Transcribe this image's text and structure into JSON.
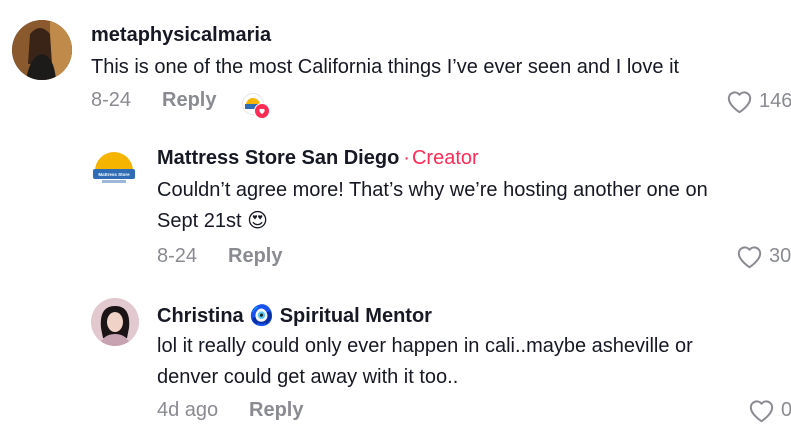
{
  "comments": [
    {
      "username": "metaphysicalmaria",
      "text": "This is one of the most California things I’ve ever seen and I love it",
      "date": "8-24",
      "reply_label": "Reply",
      "likes": "146",
      "creator_liked": true
    },
    {
      "username": "Mattress Store San Diego",
      "badge_separator": "·",
      "badge": "Creator",
      "text_line1": "Couldn’t agree more! That’s why we’re hosting another one on",
      "text_line2": "Sept 21st",
      "emoji": "😍",
      "date": "8-24",
      "reply_label": "Reply",
      "likes": "30",
      "avatar_text": "Mattress Store"
    },
    {
      "username": "Christina",
      "username_emoji": "🧿",
      "username_suffix": "Spiritual Mentor",
      "text_line1": "lol it really could only ever happen in cali..maybe asheville or",
      "text_line2": "denver could get away with it too..",
      "date": "4d ago",
      "reply_label": "Reply",
      "likes": "0"
    }
  ],
  "colors": {
    "accent": "#fe2c55",
    "muted": "#8a8b91",
    "text": "#161823"
  }
}
